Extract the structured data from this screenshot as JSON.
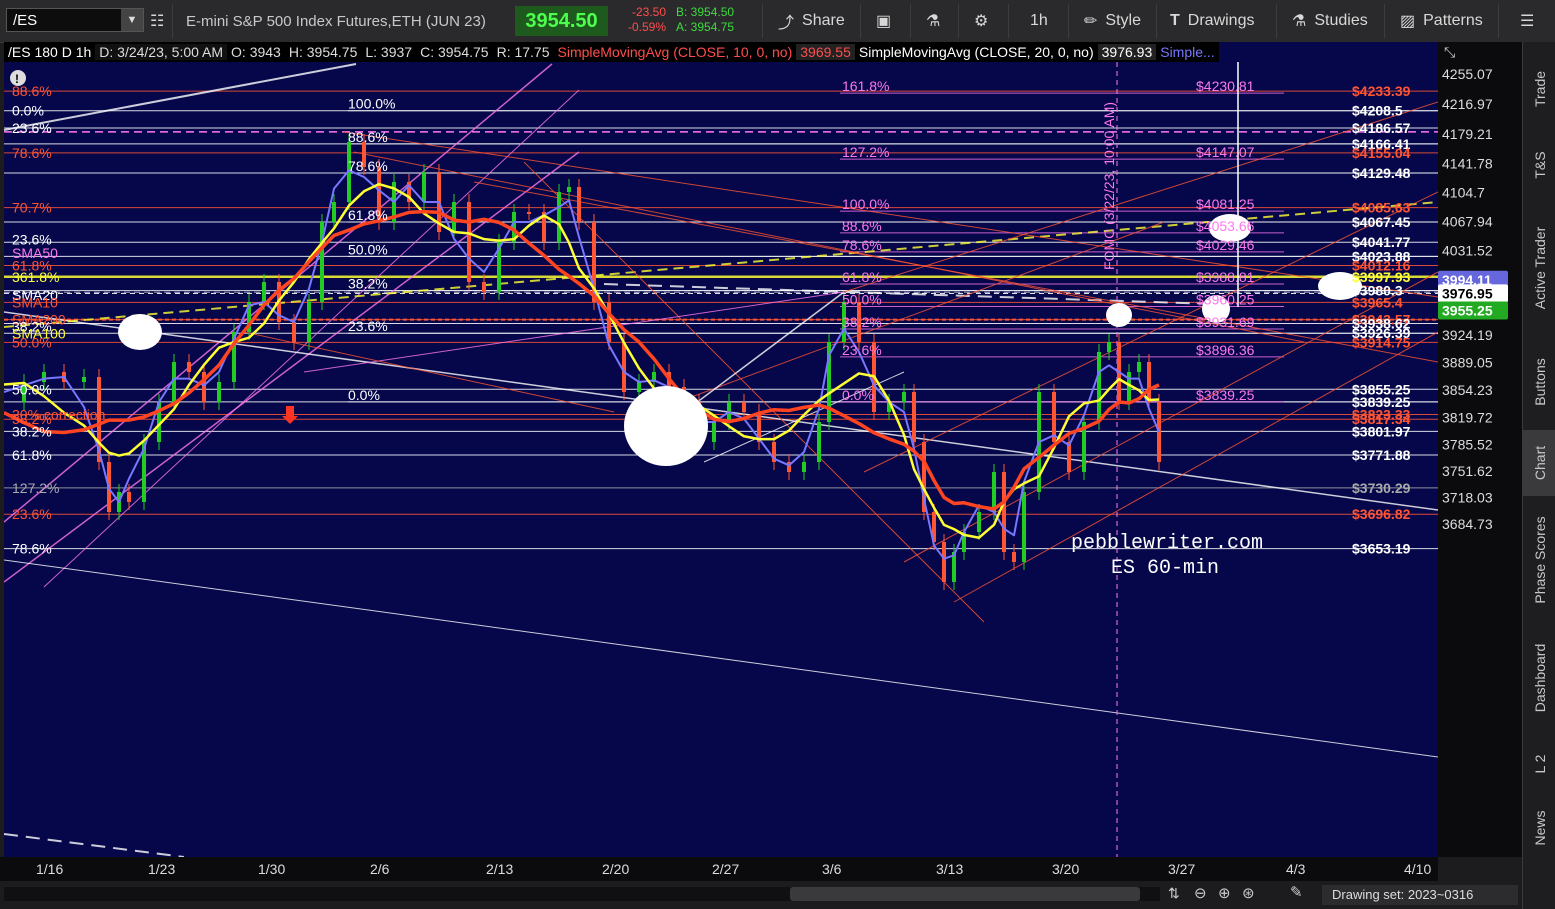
{
  "toolbar": {
    "symbol": "/ES",
    "description": "E-mini S&P 500 Index Futures,ETH (JUN 23)",
    "last_price": "3954.50",
    "change": "-23.50",
    "change_pct": "-0.59%",
    "bid": "B: 3954.50",
    "ask": "A: 3954.75",
    "share_label": "Share",
    "timeframe_label": "1h",
    "style_label": "Style",
    "drawings_label": "Drawings",
    "studies_label": "Studies",
    "patterns_label": "Patterns"
  },
  "infobar": {
    "symbol_period": "/ES 180 D 1h",
    "date": "D: 3/24/23, 5:00 AM",
    "open": "O: 3943",
    "high": "H: 3954.75",
    "low": "L: 3937",
    "close": "C: 3954.75",
    "range": "R: 17.75",
    "sma10_label": "SimpleMovingAvg (CLOSE, 10, 0, no)",
    "sma10_value": "3969.55",
    "sma20_label": "SimpleMovingAvg (CLOSE, 20, 0, no)",
    "sma20_value": "3976.93",
    "more": "Simple..."
  },
  "colors": {
    "background": "#05074a",
    "sma10": "#ffff33",
    "sma20": "#ff4422",
    "short_avg": "#7777ff",
    "price": "#22cc22",
    "fib_red": "#ff5533",
    "fib_pink": "#ff77ee",
    "white": "#ffffff"
  },
  "y_axis": {
    "ticks": [
      {
        "label": "4255.07",
        "v": 4255.07
      },
      {
        "label": "4216.97",
        "v": 4216.97
      },
      {
        "label": "4179.21",
        "v": 4179.21
      },
      {
        "label": "4141.78",
        "v": 4141.78
      },
      {
        "label": "4104.7",
        "v": 4104.7
      },
      {
        "label": "4067.94",
        "v": 4067.94
      },
      {
        "label": "4031.52",
        "v": 4031.52
      },
      {
        "label": "3924.19",
        "v": 3924.19
      },
      {
        "label": "3889.05",
        "v": 3889.05
      },
      {
        "label": "3854.23",
        "v": 3854.23
      },
      {
        "label": "3819.72",
        "v": 3819.72
      },
      {
        "label": "3785.52",
        "v": 3785.52
      },
      {
        "label": "3751.62",
        "v": 3751.62
      },
      {
        "label": "3718.03",
        "v": 3718.03
      },
      {
        "label": "3684.73",
        "v": 3684.73
      }
    ],
    "badges": [
      {
        "label": "3994.11",
        "v": 3994.11,
        "bg": "#6666dd",
        "fg": "#ffffff"
      },
      {
        "label": "3976.95",
        "v": 3976.95,
        "bg": "#ffffff",
        "fg": "#000000"
      },
      {
        "label": "3955.25",
        "v": 3955.25,
        "bg": "#22aa22",
        "fg": "#ffffff"
      }
    ]
  },
  "x_axis": {
    "labels": [
      "1/16",
      "1/23",
      "1/30",
      "2/6",
      "2/13",
      "2/20",
      "2/27",
      "3/6",
      "3/13",
      "3/20",
      "3/27",
      "4/3",
      "4/10"
    ]
  },
  "fib_left": [
    {
      "label": "88.6%",
      "v": 4233.39,
      "color": "#ff5533"
    },
    {
      "label": "0.0%",
      "v": 4208.5,
      "color": "#ffffff"
    },
    {
      "label": "23.6%",
      "v": 4186.57,
      "color": "#ffffff"
    },
    {
      "label": "78.6%",
      "v": 4155.0,
      "color": "#ff5533"
    },
    {
      "label": "70.7%",
      "v": 4085.63,
      "color": "#ff5533"
    },
    {
      "label": "23.6%",
      "v": 4045.0,
      "color": "#ffffff"
    },
    {
      "label": "SMA50",
      "v": 4028.0,
      "color": "#ff77ee"
    },
    {
      "label": "61.8%",
      "v": 4012.16,
      "color": "#ff5533"
    },
    {
      "label": "361.8%",
      "v": 3997.93,
      "color": "#ffff33"
    },
    {
      "label": "SMA20",
      "v": 3975.0,
      "color": "#ffffff"
    },
    {
      "label": "SMA10",
      "v": 3965.4,
      "color": "#ff5533"
    },
    {
      "label": "SMA200",
      "v": 3943.57,
      "color": "#ff5533"
    },
    {
      "label": "38.2%",
      "v": 3935.0,
      "color": "#ffffff"
    },
    {
      "label": "SMA100",
      "v": 3926.0,
      "color": "#ffff33"
    },
    {
      "label": "50.0%",
      "v": 3914.75,
      "color": "#ff5533"
    },
    {
      "label": "50.0%",
      "v": 3855.25,
      "color": "#ffffff"
    },
    {
      "label": "20% correction",
      "v": 3823.33,
      "color": "#ff5533"
    },
    {
      "label": "38.2%",
      "v": 3817.34,
      "color": "#ff5533"
    },
    {
      "label": "38.2%",
      "v": 3801.97,
      "color": "#ffffff"
    },
    {
      "label": "61.8%",
      "v": 3771.88,
      "color": "#ffffff"
    },
    {
      "label": "127.2%",
      "v": 3730.29,
      "color": "#aaaaaa"
    },
    {
      "label": "23.6%",
      "v": 3696.82,
      "color": "#ff5533"
    },
    {
      "label": "78.6%",
      "v": 3653.19,
      "color": "#ffffff"
    }
  ],
  "fib_mid": [
    {
      "label": "100.0%",
      "v": 4208.5
    },
    {
      "label": "88.6%",
      "v": 4166.41
    },
    {
      "label": "78.6%",
      "v": 4129.48
    },
    {
      "label": "61.8%",
      "v": 4067.45
    },
    {
      "label": "50.0%",
      "v": 4023.88
    },
    {
      "label": "38.2%",
      "v": 3980.3
    },
    {
      "label": "23.6%",
      "v": 3926.39
    },
    {
      "label": "0.0%",
      "v": 3839.25
    }
  ],
  "fib_pink": [
    {
      "label": "161.8%",
      "price": "$4230.81",
      "v": 4230.81
    },
    {
      "label": "127.2%",
      "price": "$4147.07",
      "v": 4147.07
    },
    {
      "label": "100.0%",
      "price": "$4081.25",
      "v": 4081.25
    },
    {
      "label": "88.6%",
      "price": "$4053.66",
      "v": 4053.66
    },
    {
      "label": "78.6%",
      "price": "$4029.46",
      "v": 4029.46
    },
    {
      "label": "61.8%",
      "price": "$3988.81",
      "v": 3988.81
    },
    {
      "label": "50.0%",
      "price": "$3960.25",
      "v": 3960.25
    },
    {
      "label": "38.2%",
      "price": "$3931.69",
      "v": 3931.69
    },
    {
      "label": "23.6%",
      "price": "$3896.36",
      "v": 3896.36
    },
    {
      "label": "0.0%",
      "price": "$3839.25",
      "v": 3839.25
    }
  ],
  "right_levels": [
    {
      "label": "$4233.39",
      "v": 4233.39,
      "color": "#ff5533"
    },
    {
      "label": "$4208.5",
      "v": 4208.5,
      "color": "#ffffff"
    },
    {
      "label": "$4186.57",
      "v": 4186.57,
      "color": "#ffffff"
    },
    {
      "label": "$4166.41",
      "v": 4166.41,
      "color": "#ffffff"
    },
    {
      "label": "$4155.04",
      "v": 4155.0,
      "color": "#ff5533"
    },
    {
      "label": "$4129.48",
      "v": 4129.48,
      "color": "#ffffff"
    },
    {
      "label": "$4085.63",
      "v": 4085.63,
      "color": "#ff5533"
    },
    {
      "label": "$4067.45",
      "v": 4067.45,
      "color": "#ffffff"
    },
    {
      "label": "$4041.77",
      "v": 4041.77,
      "color": "#ffffff"
    },
    {
      "label": "$4023.88",
      "v": 4023.88,
      "color": "#ffffff"
    },
    {
      "label": "$4012.16",
      "v": 4012.16,
      "color": "#ff5533"
    },
    {
      "label": "$3997.93",
      "v": 3997.93,
      "color": "#ffff33"
    },
    {
      "label": "$3980.3",
      "v": 3980.3,
      "color": "#ffffff"
    },
    {
      "label": "$3965.4",
      "v": 3965.4,
      "color": "#ff5533"
    },
    {
      "label": "$3943.57",
      "v": 3943.57,
      "color": "#ff5533"
    },
    {
      "label": "$3938.62",
      "v": 3938.62,
      "color": "#ffffff"
    },
    {
      "label": "$3926.39",
      "v": 3926.39,
      "color": "#ffffff"
    },
    {
      "label": "$3914.75",
      "v": 3914.75,
      "color": "#ff5533"
    },
    {
      "label": "$3855.25",
      "v": 3855.25,
      "color": "#ffffff"
    },
    {
      "label": "$3839.25",
      "v": 3839.25,
      "color": "#ffffff"
    },
    {
      "label": "$3823.33",
      "v": 3823.33,
      "color": "#ff5533"
    },
    {
      "label": "$3817.34",
      "v": 3817.34,
      "color": "#ff5533"
    },
    {
      "label": "$3801.97",
      "v": 3801.97,
      "color": "#ffffff"
    },
    {
      "label": "$3771.88",
      "v": 3771.88,
      "color": "#ffffff"
    },
    {
      "label": "$3730.29",
      "v": 3730.29,
      "color": "#aaaaaa"
    },
    {
      "label": "$3696.82",
      "v": 3696.82,
      "color": "#ff5533"
    },
    {
      "label": "$3653.19",
      "v": 3653.19,
      "color": "#ffffff"
    }
  ],
  "annotations": {
    "fomc": "FOMC (3/22/23, 10:00 AM)",
    "watermark_1": "pebblewriter.com",
    "watermark_2": "ES 60-min"
  },
  "sidebar": {
    "tabs": [
      "Trade",
      "T&S",
      "Active Trader",
      "Buttons",
      "Chart",
      "Phase Scores",
      "Dashboard",
      "L 2",
      "News"
    ],
    "active": "Chart"
  },
  "bottom": {
    "drawing_set": "Drawing set: 2023~0316"
  }
}
